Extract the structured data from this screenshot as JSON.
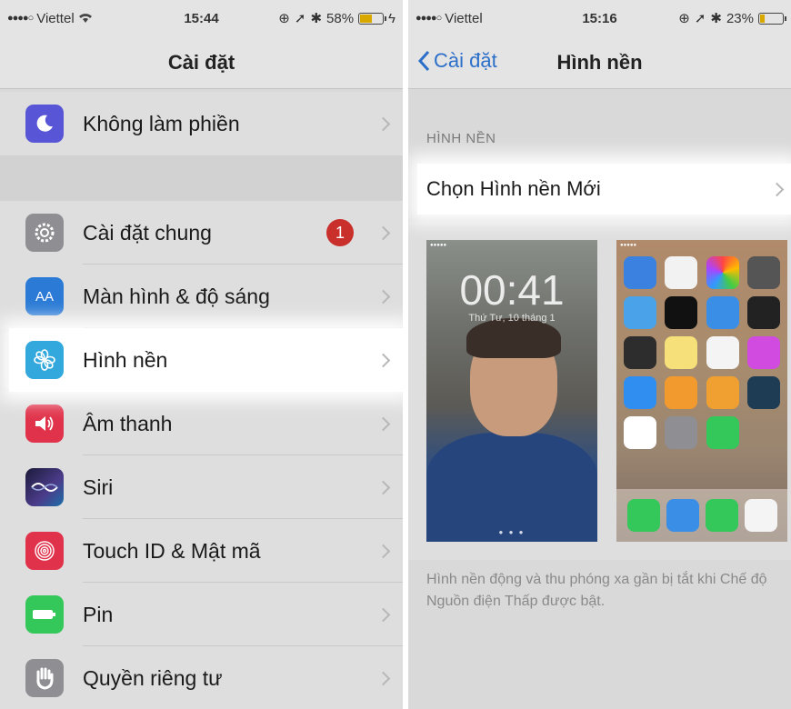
{
  "left": {
    "status": {
      "carrier": "Viettel",
      "time": "15:44",
      "battery_text": "58%",
      "battery_level": 0.58
    },
    "nav_title": "Cài đặt",
    "items": [
      {
        "label": "Không làm phiền",
        "icon": "moon-icon",
        "color": "#5856d6"
      },
      {
        "label": "Cài đặt chung",
        "icon": "gear-icon",
        "color": "#8e8e93",
        "badge": "1"
      },
      {
        "label": "Màn hình & độ sáng",
        "icon": "text-size-icon",
        "color": "#2a7ad6"
      },
      {
        "label": "Hình nền",
        "icon": "flower-icon",
        "color": "#33a8dc"
      },
      {
        "label": "Âm thanh",
        "icon": "speaker-icon",
        "color": "#e0334b"
      },
      {
        "label": "Siri",
        "icon": "siri-icon",
        "color": "#1b1b3a"
      },
      {
        "label": "Touch ID & Mật mã",
        "icon": "fingerprint-icon",
        "color": "#e0334b"
      },
      {
        "label": "Pin",
        "icon": "battery-icon",
        "color": "#34c759"
      },
      {
        "label": "Quyền riêng tư",
        "icon": "hand-icon",
        "color": "#8e8e93"
      }
    ]
  },
  "right": {
    "status": {
      "carrier": "Viettel",
      "time": "15:16",
      "battery_text": "23%",
      "battery_level": 0.23
    },
    "back_label": "Cài đặt",
    "nav_title": "Hình nền",
    "section_header": "HÌNH NỀN",
    "choose_label": "Chọn Hình nền Mới",
    "lock_preview": {
      "time": "00:41",
      "date": "Thứ Tư, 10 tháng 1"
    },
    "footer": "Hình nền động và thu phóng xa gần bị tắt khi Chế độ Nguồn điện Thấp được bật."
  }
}
